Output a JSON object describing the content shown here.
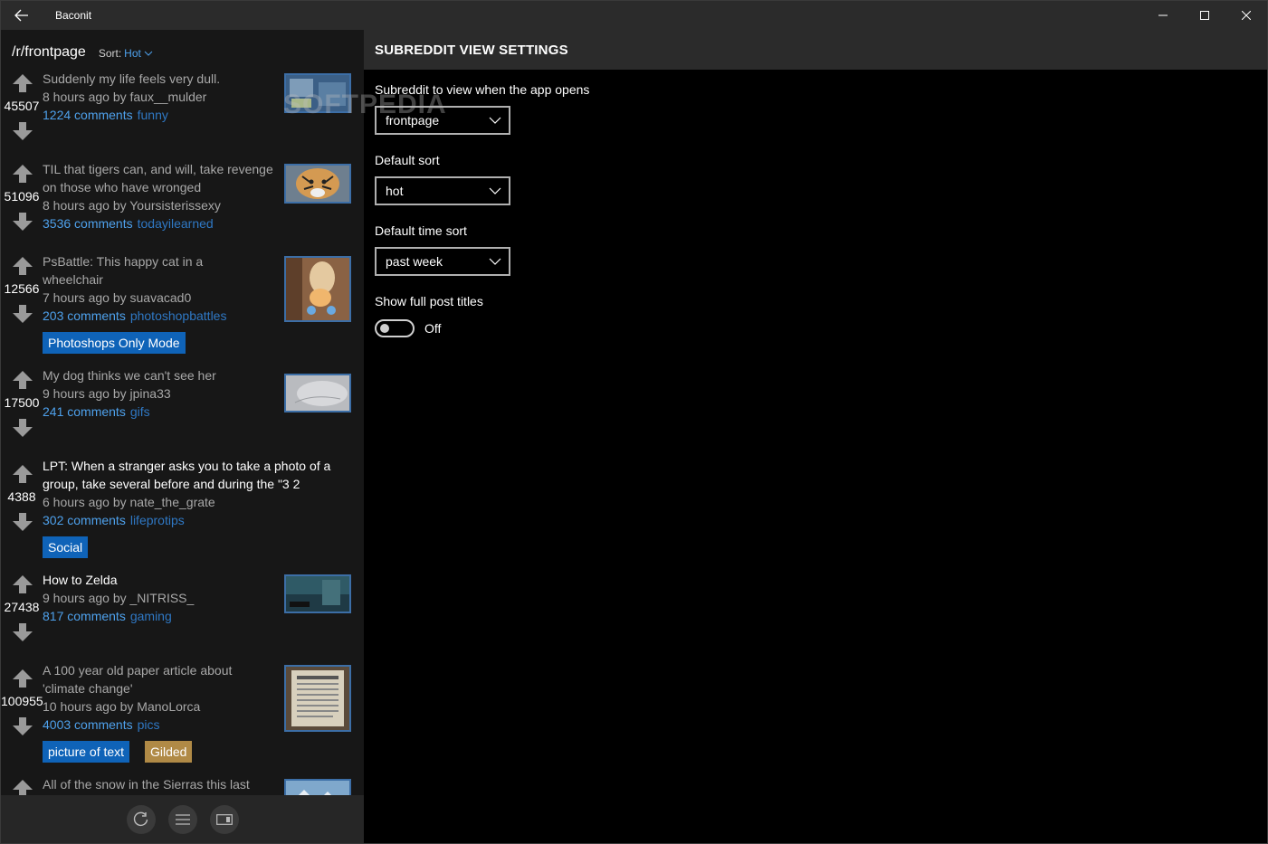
{
  "app": {
    "title": "Baconit",
    "back_icon": "back-arrow-icon",
    "window_buttons": [
      "minimize-icon",
      "maximize-icon",
      "close-icon"
    ]
  },
  "watermark": "SOFTPEDIA",
  "left": {
    "subreddit": "/r/frontpage",
    "sort_label": "Sort:",
    "sort_value": "Hot",
    "posts": [
      {
        "score": "45507",
        "title": "Suddenly my life feels very dull.",
        "meta": "8 hours ago by faux__mulder",
        "comments": "1224 comments",
        "subreddit": "funny",
        "read": true
      },
      {
        "score": "51096",
        "title": "TIL that tigers can, and will, take revenge on those who have wronged",
        "meta": "8 hours ago by Yoursisterissexy",
        "comments": "3536 comments",
        "subreddit": "todayilearned",
        "read": true
      },
      {
        "score": "12566",
        "title": "PsBattle: This happy cat in a wheelchair",
        "meta": "7 hours ago by suavacad0",
        "comments": "203 comments",
        "subreddit": "photoshopbattles",
        "flairs": [
          "Photoshops Only Mode"
        ],
        "read": true
      },
      {
        "score": "17500",
        "title": "My dog thinks we can't see her",
        "meta": "9 hours ago by jpina33",
        "comments": "241 comments",
        "subreddit": "gifs",
        "read": true
      },
      {
        "score": "4388",
        "title": "LPT: When a stranger asks you to take a photo of a group, take several before and during the \"3 2",
        "meta": "6 hours ago by nate_the_grate",
        "comments": "302 comments",
        "subreddit": "lifeprotips",
        "flairs": [
          "Social"
        ],
        "read": false
      },
      {
        "score": "27438",
        "title": "How to Zelda",
        "meta": "9 hours ago by _NITRISS_",
        "comments": "817 comments",
        "subreddit": "gaming",
        "read": false
      },
      {
        "score": "100955",
        "title": "A 100 year old paper article about 'climate change'",
        "meta": "10 hours ago by ManoLorca",
        "comments": "4003 comments",
        "subreddit": "pics",
        "flairs": [
          "picture of text",
          "Gilded"
        ],
        "read": true
      },
      {
        "score": "",
        "title": "All of the snow in the Sierras this last",
        "meta": "",
        "comments": "",
        "subreddit": "",
        "read": true
      }
    ],
    "bottom_buttons": [
      "refresh-icon",
      "menu-icon",
      "fullscreen-icon"
    ]
  },
  "settings": {
    "header": "SUBREDDIT VIEW SETTINGS",
    "startup_label": "Subreddit to view when the app opens",
    "startup_value": "frontpage",
    "sort_label": "Default sort",
    "sort_value": "hot",
    "time_sort_label": "Default time sort",
    "time_sort_value": "past week",
    "full_titles_label": "Show full post titles",
    "full_titles_state": "Off"
  },
  "colors": {
    "accent": "#4ea1ec",
    "flair": "#0f63b8",
    "gilded": "#b08a46"
  }
}
